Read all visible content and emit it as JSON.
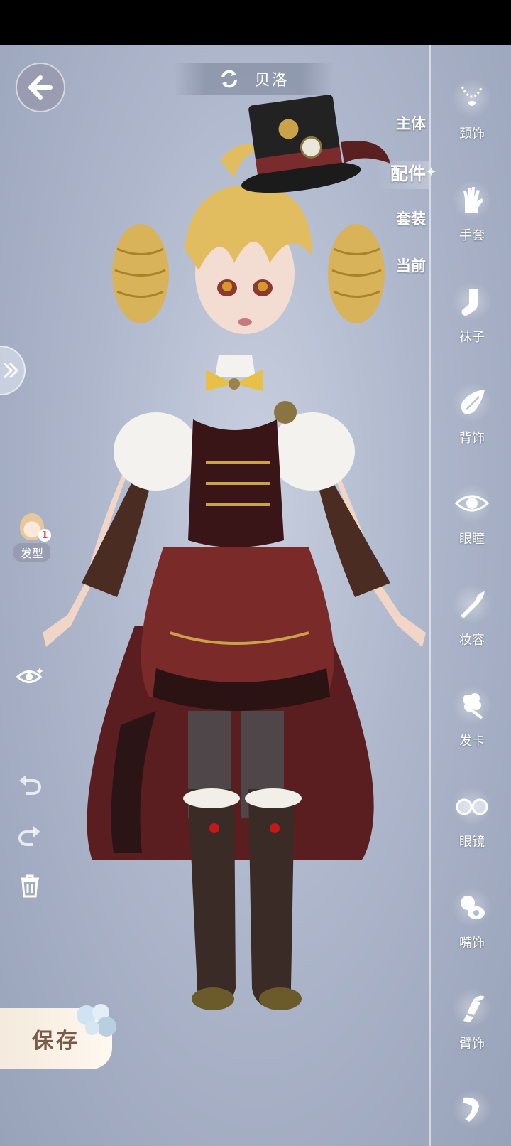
{
  "header": {
    "character_name": "贝洛"
  },
  "categories": [
    {
      "label": "主体",
      "active": false
    },
    {
      "label": "配件",
      "active": true
    },
    {
      "label": "套装",
      "active": false
    },
    {
      "label": "当前",
      "active": false
    }
  ],
  "sidebar": {
    "items": [
      {
        "label": "颈饰",
        "icon": "necklace-icon"
      },
      {
        "label": "手套",
        "icon": "glove-icon"
      },
      {
        "label": "袜子",
        "icon": "sock-icon"
      },
      {
        "label": "背饰",
        "icon": "wing-icon"
      },
      {
        "label": "眼瞳",
        "icon": "eye-icon"
      },
      {
        "label": "妆容",
        "icon": "makeup-brush-icon"
      },
      {
        "label": "发卡",
        "icon": "hairpin-flower-icon"
      },
      {
        "label": "眼镜",
        "icon": "glasses-icon"
      },
      {
        "label": "嘴饰",
        "icon": "pacifier-icon"
      },
      {
        "label": "臂饰",
        "icon": "arm-ribbon-icon"
      },
      {
        "label": "",
        "icon": "more-accessory-icon"
      }
    ]
  },
  "left_tools": {
    "hair_label": "发型",
    "hair_badge": "1"
  },
  "save_label": "保存"
}
